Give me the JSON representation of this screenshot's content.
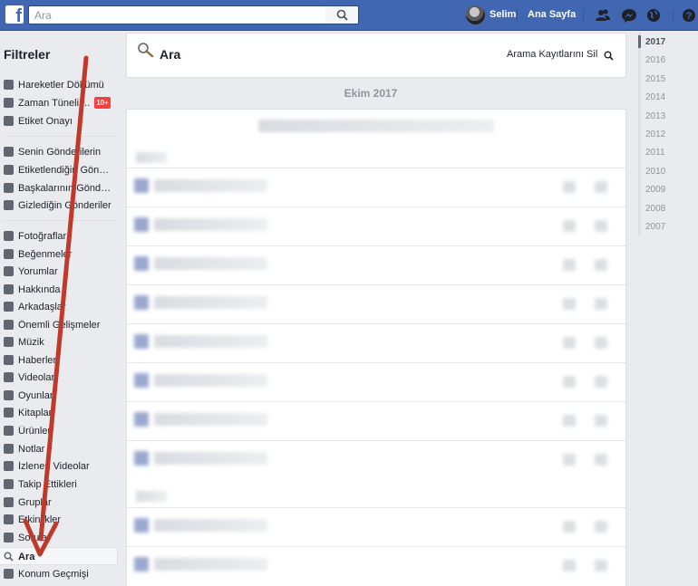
{
  "topbar": {
    "logo": "f",
    "search_placeholder": "Ara",
    "search_icon": "search-icon",
    "user_name": "Selim",
    "home_label": "Ana Sayfa",
    "icons": [
      "friends-icon",
      "messenger-icon",
      "globe-icon",
      "help-icon"
    ],
    "accent_color": "#4267b2"
  },
  "filters": {
    "title": "Filtreler",
    "badge": "10+",
    "items": [
      {
        "label": "Hareketler Dökümü",
        "icon": "activity-log-icon"
      },
      {
        "label": "Zaman Tüneli ...",
        "icon": "timeline-icon"
      },
      {
        "label": "Etiket Onayı",
        "icon": "tag-icon"
      },
      {
        "label": "Senin Gönderilerin",
        "icon": "person-icon"
      },
      {
        "label": "Etiketlendiğin Gönde...",
        "icon": "tag-icon"
      },
      {
        "label": "Başkalarının Gönderi...",
        "icon": "comment-icon"
      },
      {
        "label": "Gizlediğin Gönderiler",
        "icon": "hidden-icon"
      },
      {
        "label": "Fotoğraflar",
        "icon": "photo-icon"
      },
      {
        "label": "Beğenmeler",
        "icon": "like-icon"
      },
      {
        "label": "Yorumlar",
        "icon": "comment-icon"
      },
      {
        "label": "Hakkında",
        "icon": "info-icon"
      },
      {
        "label": "Arkadaşlar",
        "icon": "friends-icon"
      },
      {
        "label": "Önemli Gelişmeler",
        "icon": "flag-icon"
      },
      {
        "label": "Müzik",
        "icon": "music-icon"
      },
      {
        "label": "Haberler",
        "icon": "news-icon"
      },
      {
        "label": "Videolar",
        "icon": "video-icon"
      },
      {
        "label": "Oyunlar",
        "icon": "game-icon"
      },
      {
        "label": "Kitaplar",
        "icon": "book-icon"
      },
      {
        "label": "Ürünler",
        "icon": "bag-icon"
      },
      {
        "label": "Notlar",
        "icon": "note-icon"
      },
      {
        "label": "İzlenen Videolar",
        "icon": "video-icon"
      },
      {
        "label": "Takip Ettikleri",
        "icon": "rss-icon"
      },
      {
        "label": "Gruplar",
        "icon": "group-icon"
      },
      {
        "label": "Etkinlikler",
        "icon": "calendar-icon"
      },
      {
        "label": "Sorular",
        "icon": "question-icon"
      },
      {
        "label": "Ara",
        "icon": "search-icon"
      },
      {
        "label": "Konum Geçmişi",
        "icon": "location-icon"
      }
    ]
  },
  "main": {
    "title": "Ara",
    "clear_label": "Arama Kayıtlarını Sil",
    "month": "Ekim 2017"
  },
  "years": [
    "2017",
    "2016",
    "2015",
    "2014",
    "2013",
    "2012",
    "2011",
    "2010",
    "2009",
    "2008",
    "2007"
  ],
  "annotation_color": "#c0392b"
}
